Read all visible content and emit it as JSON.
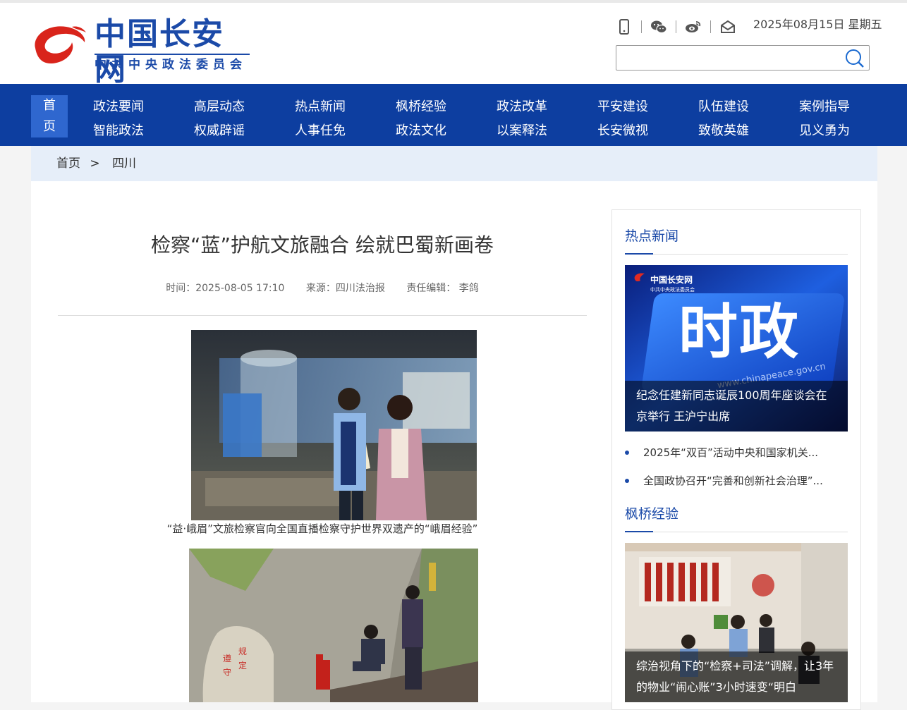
{
  "header": {
    "site_name": "中国长安网",
    "site_sub": "中共中央政法委员会",
    "date": "2025年08月15日 星期五",
    "search": {
      "value": "",
      "placeholder": ""
    },
    "icons": [
      "mobile-icon",
      "wechat-icon",
      "weibo-icon",
      "email-icon",
      "search-icon"
    ]
  },
  "nav": {
    "home_label_1": "首",
    "home_label_2": "页",
    "columns": [
      {
        "top": "政法要闻",
        "bottom": "智能政法"
      },
      {
        "top": "高层动态",
        "bottom": "权威辟谣"
      },
      {
        "top": "热点新闻",
        "bottom": "人事任免"
      },
      {
        "top": "枫桥经验",
        "bottom": "政法文化"
      },
      {
        "top": "政法改革",
        "bottom": "以案释法"
      },
      {
        "top": "平安建设",
        "bottom": "长安微视"
      },
      {
        "top": "队伍建设",
        "bottom": "致敬英雄"
      },
      {
        "top": "案例指导",
        "bottom": "见义勇为"
      }
    ]
  },
  "breadcrumb": {
    "home": "首页",
    "separator": ">",
    "current": "四川"
  },
  "article": {
    "title": "检察“蓝”护航文旅融合 绘就巴蜀新画卷",
    "time": "时间：2025-08-05 17:10",
    "source": "来源：四川法治报",
    "editor": "责任编辑：  李鸽",
    "caption1": "“益·峨眉”文旅检察官向全国直播检察守护世界双遗产的“峨眉经验”"
  },
  "sidebar": {
    "hot": {
      "title": "热点新闻",
      "feature_caption": "纪念任建新同志诞辰100周年座谈会在京举行 王沪宁出席",
      "feature_logo": "中国长安网",
      "feature_logo_sub": "中共中央政法委员会",
      "feature_big": "时政",
      "feature_url": "www.chinapeace.gov.cn",
      "items": [
        "2025年“双百”活动中央和国家机关...",
        "全国政协召开“完善和创新社会治理”..."
      ]
    },
    "fengqiao": {
      "title": "枫桥经验",
      "feature_caption": "综治视角下的“检察+司法”调解，让3年的物业“闹心账”3小时速变“明白"
    }
  },
  "colors": {
    "brand_blue": "#0d3ea0",
    "accent_blue": "#1b4aa8",
    "home_blue": "#2f67cf",
    "logo_red": "#d9241b"
  }
}
